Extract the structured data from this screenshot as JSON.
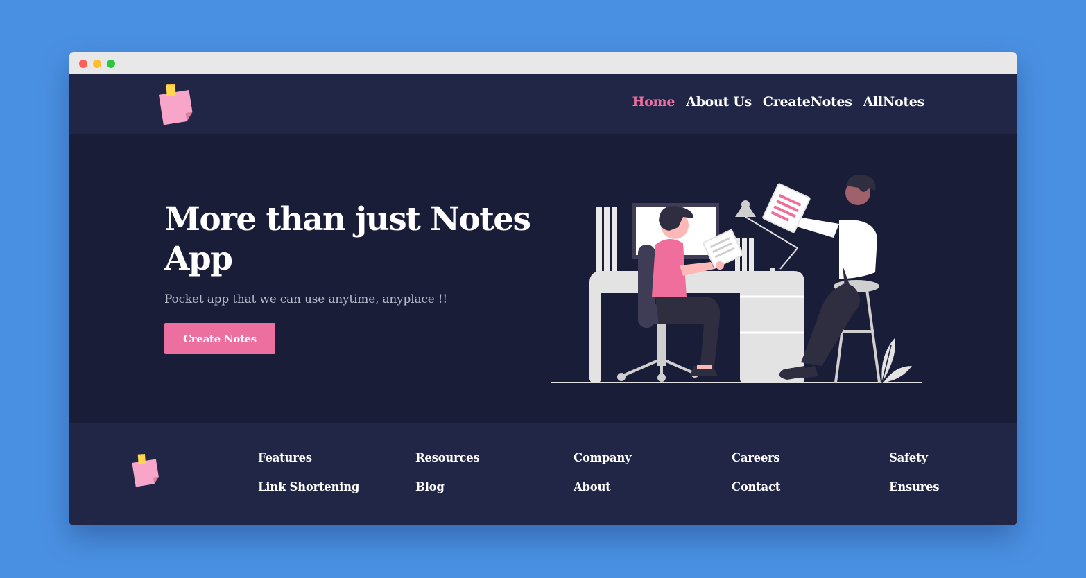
{
  "nav": {
    "links": [
      {
        "label": "Home",
        "active": true
      },
      {
        "label": "About Us",
        "active": false
      },
      {
        "label": "CreateNotes",
        "active": false
      },
      {
        "label": "AllNotes",
        "active": false
      }
    ]
  },
  "hero": {
    "title": "More than just Notes App",
    "subtitle": "Pocket app that we can use anytime, anyplace !!",
    "cta_label": "Create Notes"
  },
  "footer": {
    "columns": [
      {
        "links": [
          "Features",
          "Link Shortening"
        ]
      },
      {
        "links": [
          "Resources",
          "Blog"
        ]
      },
      {
        "links": [
          "Company",
          "About"
        ]
      },
      {
        "links": [
          "Careers",
          "Contact"
        ]
      },
      {
        "links": [
          "Safety",
          "Ensures"
        ]
      }
    ]
  },
  "colors": {
    "page_background": "#4a90e2",
    "navbar": "#212647",
    "hero_background": "#1a1d37",
    "accent_pink": "#ec6f9f",
    "text_white": "#ffffff",
    "subtitle_gray": "#b7bccd"
  },
  "icons": {
    "logo": "sticky-note-icon",
    "window_controls": [
      "close-dot-icon",
      "minimize-dot-icon",
      "maximize-dot-icon"
    ]
  }
}
